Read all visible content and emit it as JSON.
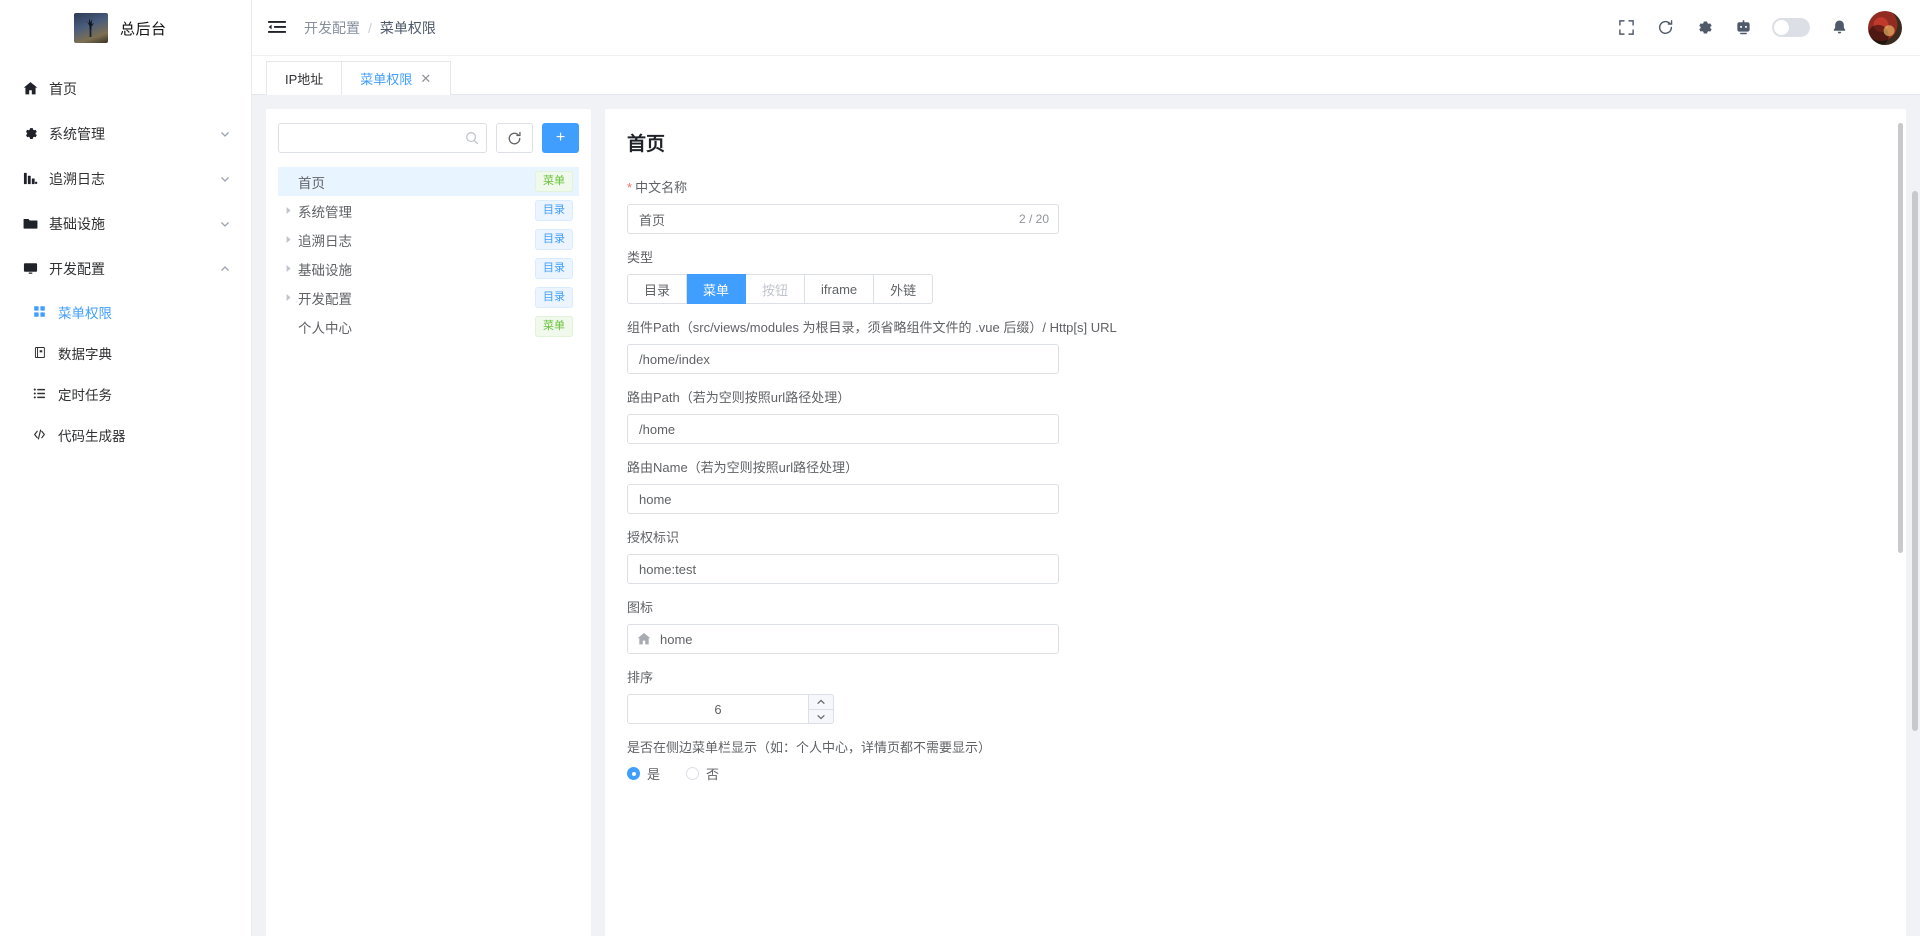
{
  "brand": {
    "title": "总后台",
    "logo_icon": "app-logo"
  },
  "sidebar": {
    "items": [
      {
        "label": "首页",
        "icon": "home-icon",
        "expandable": false,
        "active": false
      },
      {
        "label": "系统管理",
        "icon": "gear-icon",
        "expandable": true,
        "active": false
      },
      {
        "label": "追溯日志",
        "icon": "log-icon",
        "expandable": true,
        "active": false
      },
      {
        "label": "基础设施",
        "icon": "folder-icon",
        "expandable": true,
        "active": false
      },
      {
        "label": "开发配置",
        "icon": "monitor-icon",
        "expandable": true,
        "active": true
      }
    ],
    "sub_items": [
      {
        "label": "菜单权限",
        "icon": "grid-icon",
        "active": true
      },
      {
        "label": "数据字典",
        "icon": "dictionary-icon",
        "active": false
      },
      {
        "label": "定时任务",
        "icon": "list-icon",
        "active": false
      },
      {
        "label": "代码生成器",
        "icon": "code-icon",
        "active": false
      }
    ]
  },
  "topbar": {
    "collapse_icon": "menu-fold-icon",
    "breadcrumb": [
      "开发配置",
      "菜单权限"
    ],
    "breadcrumb_separator": "/",
    "tools": [
      {
        "name": "fullscreen-icon"
      },
      {
        "name": "refresh-icon"
      },
      {
        "name": "gear-icon"
      },
      {
        "name": "robot-icon"
      }
    ],
    "theme_switch_on": false,
    "bell_icon": "bell-icon",
    "avatar": "user-avatar"
  },
  "tabs": [
    {
      "label": "IP地址",
      "active": false,
      "closable": false
    },
    {
      "label": "菜单权限",
      "active": true,
      "closable": true,
      "close_icon": "close-icon"
    }
  ],
  "tree_panel": {
    "search": {
      "value": "",
      "placeholder": "",
      "icon": "search-icon"
    },
    "refresh_button": {
      "icon": "refresh-icon",
      "label": ""
    },
    "add_button": {
      "icon": "plus-icon",
      "label": "+"
    },
    "nodes": [
      {
        "label": "首页",
        "tag": "菜单",
        "tag_type": "menu",
        "expandable": false,
        "selected": true
      },
      {
        "label": "系统管理",
        "tag": "目录",
        "tag_type": "dir",
        "expandable": true,
        "selected": false
      },
      {
        "label": "追溯日志",
        "tag": "目录",
        "tag_type": "dir",
        "expandable": true,
        "selected": false
      },
      {
        "label": "基础设施",
        "tag": "目录",
        "tag_type": "dir",
        "expandable": true,
        "selected": false
      },
      {
        "label": "开发配置",
        "tag": "目录",
        "tag_type": "dir",
        "expandable": true,
        "selected": false
      },
      {
        "label": "个人中心",
        "tag": "菜单",
        "tag_type": "menu",
        "expandable": false,
        "selected": false
      }
    ]
  },
  "form": {
    "title": "首页",
    "name_field": {
      "label": "中文名称",
      "required": true,
      "value": "首页",
      "counter": "2 / 20"
    },
    "type_field": {
      "label": "类型",
      "options": [
        {
          "label": "目录",
          "active": false,
          "disabled": false
        },
        {
          "label": "菜单",
          "active": true,
          "disabled": false
        },
        {
          "label": "按钮",
          "active": false,
          "disabled": true
        },
        {
          "label": "iframe",
          "active": false,
          "disabled": false
        },
        {
          "label": "外链",
          "active": false,
          "disabled": false
        }
      ]
    },
    "component_path": {
      "label": "组件Path（src/views/modules 为根目录，须省略组件文件的 .vue 后缀）/ Http[s] URL",
      "value": "/home/index"
    },
    "route_path": {
      "label": "路由Path（若为空则按照url路径处理）",
      "value": "/home"
    },
    "route_name": {
      "label": "路由Name（若为空则按照url路径处理）",
      "value": "home"
    },
    "auth_key": {
      "label": "授权标识",
      "value": "home:test"
    },
    "icon_field": {
      "label": "图标",
      "value": "home",
      "icon": "home-icon"
    },
    "sort_field": {
      "label": "排序",
      "value": "6",
      "up_icon": "caret-up-icon",
      "down_icon": "caret-down-icon"
    },
    "sidebar_visible_field": {
      "label": "是否在侧边菜单栏显示（如：个人中心，详情页都不需要显示）",
      "options": [
        {
          "label": "是",
          "checked": true
        },
        {
          "label": "否",
          "checked": false
        }
      ]
    }
  },
  "colors": {
    "primary": "#409eff",
    "tag_menu": "#67c23a",
    "tag_dir": "#409eff",
    "required": "#f56c6c"
  }
}
